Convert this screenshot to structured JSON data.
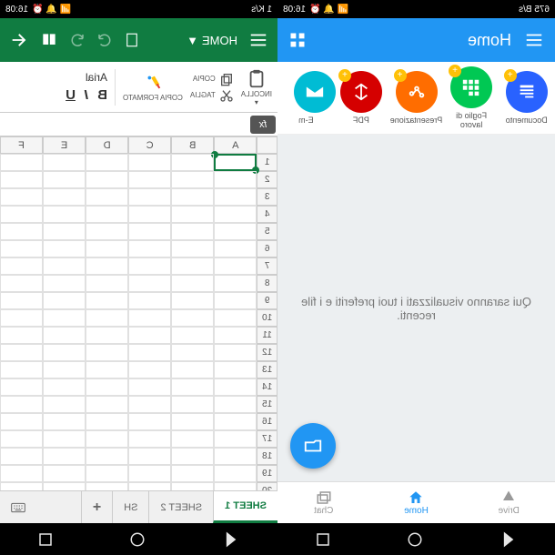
{
  "status": {
    "time": "16:08",
    "net_left": "675 B/s",
    "net_right": "1 K/s"
  },
  "home": {
    "title": "Home",
    "docs": [
      {
        "label": "Documento"
      },
      {
        "label": "Foglio di lavoro"
      },
      {
        "label": "Presentazione"
      },
      {
        "label": "PDF"
      },
      {
        "label": "E-m"
      }
    ],
    "empty": "Qui saranno visualizzati i tuoi preferiti e i file recenti.",
    "tabs": [
      {
        "label": "Drive"
      },
      {
        "label": "Home"
      },
      {
        "label": "Chat"
      }
    ]
  },
  "sheet": {
    "home": "HOME",
    "ribbon": {
      "paste": "INCOLLA",
      "copy": "COPIA",
      "cut": "TAGLIA",
      "format": "COPIA FORMATO",
      "font": "Arial"
    },
    "cols": [
      "A",
      "B",
      "C",
      "D",
      "E",
      "F"
    ],
    "rows": 22,
    "tabs": [
      "SHEET 1",
      "SHEET 2",
      "SH"
    ]
  }
}
